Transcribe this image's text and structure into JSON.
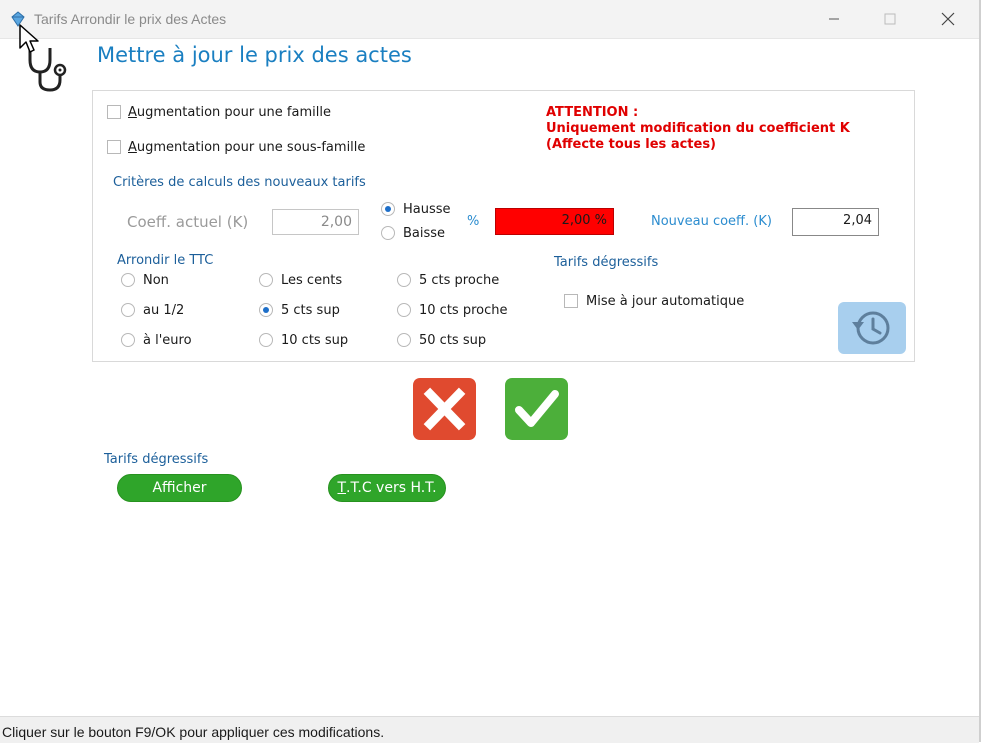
{
  "window": {
    "title": "Tarifs Arrondir le prix des Actes"
  },
  "heading": "Mettre à jour le prix des actes",
  "checkboxes": {
    "famille": {
      "pre": "",
      "u": "A",
      "rest": "ugmentation pour une famille",
      "checked": false
    },
    "sous_famille": {
      "pre": "",
      "u": "A",
      "rest": "ugmentation pour une sous-famille",
      "checked": false
    },
    "auto": {
      "label": "Mise à jour automatique",
      "checked": false
    }
  },
  "attention": {
    "line1": "ATTENTION :",
    "line2": "Uniquement modification du coefficient K",
    "line3": "(Affecte tous les actes)"
  },
  "criteria": {
    "section_label": "Critères de calculs des nouveaux tarifs",
    "coeff_label": "Coeff. actuel (K)",
    "coeff_value": "2,00",
    "hausse": "Hausse",
    "baisse": "Baisse",
    "selected_direction": "Hausse",
    "pct_symbol": "%",
    "pct_value": "2,00 %",
    "pct_color": "#ff0000",
    "new_coeff_label": "Nouveau coeff. (K)",
    "new_coeff_value": "2,04"
  },
  "rounding": {
    "section_label": "Arrondir le TTC",
    "selected": "5 cts sup",
    "options": [
      "Non",
      "au 1/2",
      "à l'euro",
      "Les cents",
      "5 cts sup",
      "10 cts sup",
      "5 cts proche",
      "10 cts proche",
      "50 cts sup"
    ]
  },
  "degressifs": {
    "section_label": "Tarifs dégressifs",
    "history_icon": "history-icon"
  },
  "actions": {
    "cancel_icon": "close-icon",
    "ok_icon": "check-icon"
  },
  "bottom": {
    "degressifs_label": "Tarifs dégressifs",
    "afficher": "Afficher",
    "ttc_u": "T",
    "ttc_rest": ".T.C vers H.T."
  },
  "status": "Cliquer sur le bouton F9/OK pour appliquer ces modifications.",
  "colors": {
    "accent": "#1a7fc1",
    "green": "#2fa52a",
    "red_btn": "#e04a2f",
    "green_btn": "#4caf3a"
  }
}
